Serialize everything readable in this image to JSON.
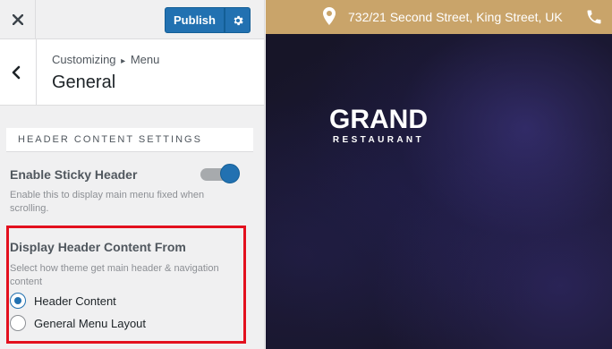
{
  "topbar": {
    "publish_label": "Publish"
  },
  "section": {
    "breadcrumb_root": "Customizing",
    "breadcrumb_separator": "▸",
    "breadcrumb_parent": "Menu",
    "title": "General"
  },
  "settings": {
    "group_header": "HEADER CONTENT SETTINGS",
    "sticky_header": {
      "label": "Enable Sticky Header",
      "description": "Enable this to display main menu fixed when scrolling.",
      "enabled": true
    },
    "display_header": {
      "label": "Display Header Content From",
      "description": "Select how theme get main header & navigation content",
      "options": [
        {
          "label": "Header Content",
          "selected": true
        },
        {
          "label": "General Menu Layout",
          "selected": false
        }
      ]
    }
  },
  "preview": {
    "address": "732/21 Second Street, King Street, UK",
    "logo_main": "GRAND",
    "logo_sub": "RESTAURANT"
  },
  "colors": {
    "accent": "#2271b1",
    "highlight": "#e3101e",
    "infobar": "#c9a46a"
  },
  "icons": [
    "close-icon",
    "gear-icon",
    "chevron-left-icon",
    "map-pin-icon",
    "phone-icon"
  ]
}
